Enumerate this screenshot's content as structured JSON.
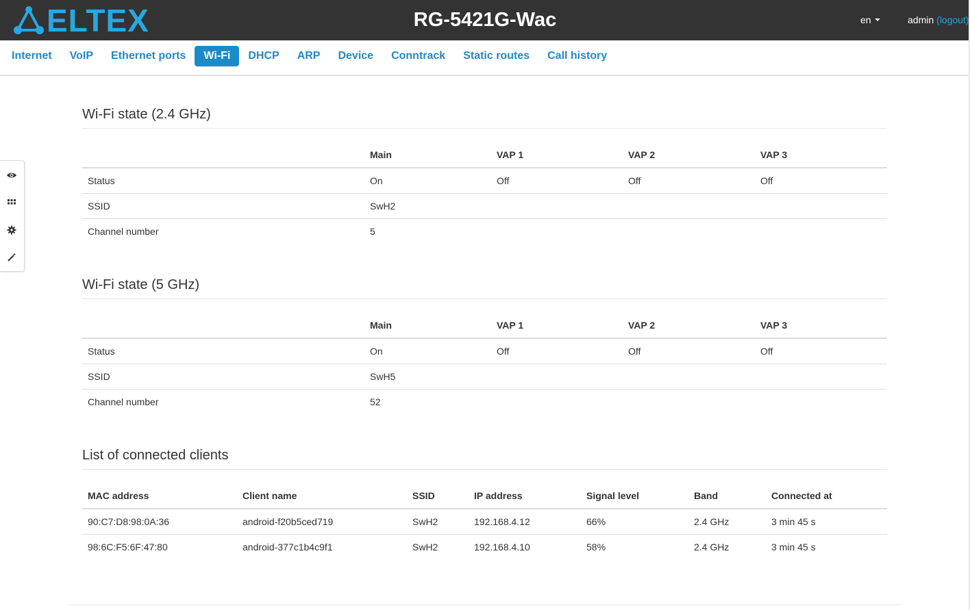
{
  "header": {
    "logo_text": "ELTEX",
    "title": "RG-5421G-Wac",
    "language": "en",
    "user": "admin",
    "logout_label": "(logout)",
    "accent_color": "#27a8e0"
  },
  "nav": {
    "tabs": [
      {
        "label": "Internet"
      },
      {
        "label": "VoIP"
      },
      {
        "label": "Ethernet ports"
      },
      {
        "label": "Wi-Fi"
      },
      {
        "label": "DHCP"
      },
      {
        "label": "ARP"
      },
      {
        "label": "Device"
      },
      {
        "label": "Conntrack"
      },
      {
        "label": "Static routes"
      },
      {
        "label": "Call history"
      }
    ],
    "active_tab": "Wi-Fi"
  },
  "sidebar": {
    "icons": [
      "eye-icon",
      "grid-icon",
      "gear-icon",
      "wand-icon"
    ]
  },
  "wifi24": {
    "title": "Wi-Fi state (2.4 GHz)",
    "headers": [
      "",
      "Main",
      "VAP 1",
      "VAP 2",
      "VAP 3"
    ],
    "rows": [
      [
        "Status",
        "On",
        "Off",
        "Off",
        "Off"
      ],
      [
        "SSID",
        "SwH2",
        "",
        "",
        ""
      ],
      [
        "Channel number",
        "5",
        "",
        "",
        ""
      ]
    ]
  },
  "wifi5": {
    "title": "Wi-Fi state (5 GHz)",
    "headers": [
      "",
      "Main",
      "VAP 1",
      "VAP 2",
      "VAP 3"
    ],
    "rows": [
      [
        "Status",
        "On",
        "Off",
        "Off",
        "Off"
      ],
      [
        "SSID",
        "SwH5",
        "",
        "",
        ""
      ],
      [
        "Channel number",
        "52",
        "",
        "",
        ""
      ]
    ]
  },
  "clients": {
    "title": "List of connected clients",
    "headers": [
      "MAC address",
      "Client name",
      "SSID",
      "IP address",
      "Signal level",
      "Band",
      "Connected at"
    ],
    "rows": [
      [
        "90:C7:D8:98:0A:36",
        "android-f20b5ced719",
        "SwH2",
        "192.168.4.12",
        "66%",
        "2.4 GHz",
        "3 min 45 s"
      ],
      [
        "98:6C:F5:6F:47:80",
        "android-377c1b4c9f1",
        "SwH2",
        "192.168.4.10",
        "58%",
        "2.4 GHz",
        "3 min 45 s"
      ]
    ]
  }
}
